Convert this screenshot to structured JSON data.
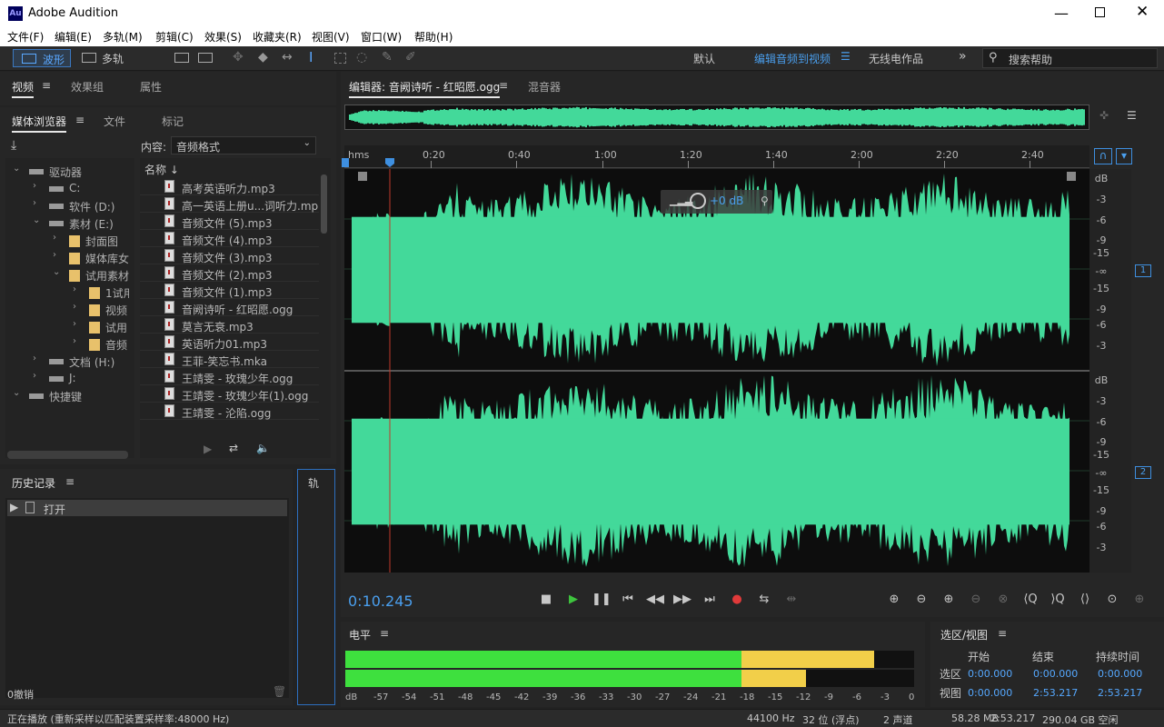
{
  "app": {
    "title": "Adobe Audition",
    "logo": "Au"
  },
  "menus": [
    "文件(F)",
    "编辑(E)",
    "多轨(M)",
    "剪辑(C)",
    "效果(S)",
    "收藏夹(R)",
    "视图(V)",
    "窗口(W)",
    "帮助(H)"
  ],
  "toolbar": {
    "waveform": "波形",
    "multitrack": "多轨",
    "workspaces": [
      "默认",
      "编辑音频到视频",
      "无线电作品"
    ],
    "search_placeholder": "搜索帮助"
  },
  "left_tabs_top": [
    "视频",
    "效果组",
    "属性"
  ],
  "media_tabs": [
    "媒体浏览器",
    "文件",
    "标记"
  ],
  "content_label": "内容:",
  "content_value": "音频格式",
  "name_header": "名称",
  "tree": [
    {
      "label": "驱动器",
      "indent": 0,
      "icon": "drive-icon"
    },
    {
      "label": "C:",
      "indent": 1,
      "icon": "drive-icon"
    },
    {
      "label": "软件 (D:)",
      "indent": 1,
      "icon": "drive-icon"
    },
    {
      "label": "素材 (E:)",
      "indent": 1,
      "icon": "drive-icon"
    },
    {
      "label": "封面图",
      "indent": 2,
      "icon": "folder-icon"
    },
    {
      "label": "媒体库女",
      "indent": 2,
      "icon": "folder-icon"
    },
    {
      "label": "试用素材",
      "indent": 2,
      "icon": "folder-icon"
    },
    {
      "label": "1试用",
      "indent": 3,
      "icon": "folder-icon"
    },
    {
      "label": "视频",
      "indent": 3,
      "icon": "folder-icon"
    },
    {
      "label": "试用",
      "indent": 3,
      "icon": "folder-icon"
    },
    {
      "label": "音频",
      "indent": 3,
      "icon": "folder-icon"
    },
    {
      "label": "文档 (H:)",
      "indent": 1,
      "icon": "drive-icon"
    },
    {
      "label": "J:",
      "indent": 1,
      "icon": "drive-icon"
    },
    {
      "label": "快捷键",
      "indent": 0,
      "icon": "shortcut-icon"
    }
  ],
  "files": [
    "高考英语听力.mp3",
    "高一英语上册u...词听力.mp3",
    "音频文件 (5).mp3",
    "音频文件 (4).mp3",
    "音频文件 (3).mp3",
    "音频文件 (2).mp3",
    "音频文件 (1).mp3",
    "音阙诗听 - 红昭愿.ogg",
    "莫言无衰.mp3",
    "英语听力01.mp3",
    "王菲-笑忘书.mka",
    "王靖雯 - 玫瑰少年.ogg",
    "王靖雯 - 玫瑰少年(1).ogg",
    "王靖雯 - 沦陷.ogg"
  ],
  "history": {
    "title": "历史记录",
    "item": "打开",
    "undo": "0撤销",
    "track_tab": "轨"
  },
  "editor": {
    "tab": "编辑器: 音阙诗听 - 红昭愿.ogg",
    "mixer": "混音器",
    "hud_db": "+0 dB",
    "time": "0:10.245"
  },
  "ruler": [
    "hms",
    "0:20",
    "0:40",
    "1:00",
    "1:20",
    "1:40",
    "2:00",
    "2:20",
    "2:40"
  ],
  "db_scale": [
    "dB",
    "-3",
    "-6",
    "-9",
    "-15",
    "-∞",
    "-15",
    "-9",
    "-6",
    "-3"
  ],
  "channels": [
    "1",
    "2"
  ],
  "levels": {
    "title": "电平",
    "scale": [
      "dB",
      "-57",
      "-54",
      "-51",
      "-48",
      "-45",
      "-42",
      "-39",
      "-36",
      "-33",
      "-30",
      "-27",
      "-24",
      "-21",
      "-18",
      "-15",
      "-12",
      "-9",
      "-6",
      "-3",
      "0"
    ],
    "left": 0.93,
    "right": 0.81
  },
  "selection": {
    "title": "选区/视图",
    "cols": [
      "开始",
      "结束",
      "持续时间"
    ],
    "rows": [
      {
        "label": "选区",
        "start": "0:00.000",
        "end": "0:00.000",
        "dur": "0:00.000"
      },
      {
        "label": "视图",
        "start": "0:00.000",
        "end": "2:53.217",
        "dur": "2:53.217"
      }
    ]
  },
  "status": {
    "left": "正在播放  (重新采样以匹配装置采样率:48000 Hz)",
    "rate": "44100 Hz",
    "bits": "32 位 (浮点)",
    "channels": "2 声道",
    "size": "58.28 MB",
    "duration": "2:53.217",
    "free": "290.04 GB 空闲"
  },
  "colors": {
    "wave": "#43d99a",
    "accent": "#3e8fe0",
    "playhead": "#c0392b"
  }
}
